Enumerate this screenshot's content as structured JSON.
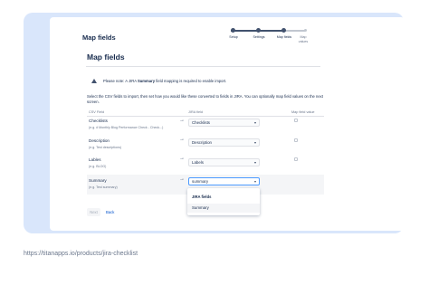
{
  "header": {
    "title": "Map fields"
  },
  "steps": [
    {
      "label": "Setup",
      "state": "done"
    },
    {
      "label": "Settings",
      "state": "done"
    },
    {
      "label": "Map fields",
      "state": "current"
    },
    {
      "label": "Map values",
      "state": "upcoming"
    }
  ],
  "section": {
    "title": "Map fields"
  },
  "notice": {
    "icon": "warning-icon",
    "prefix": "Please note: A JIRA ",
    "bold": "Summary",
    "suffix": " field mapping is required to enable import."
  },
  "description": "Select the CSV fields to import, then set how you would like these converted to fields in JIRA. You can optionally map field values on the next screen.",
  "table": {
    "headers": {
      "csv": "CSV Field",
      "jira": "JIRA field",
      "map": "Map field value"
    },
    "rows": [
      {
        "name": "Checklists",
        "example": "(e.g. # Monthly Blog Performance Check - Check...)",
        "jira": "Checklists"
      },
      {
        "name": "Description",
        "example": "(e.g. Test descriptions)",
        "jira": "Description"
      },
      {
        "name": "Lables",
        "example": "(e.g. BLOG)",
        "jira": "Labels"
      },
      {
        "name": "Summary",
        "example": "(e.g. Test summary)",
        "jira": "summary"
      }
    ]
  },
  "dropdown": {
    "group": "JIRA fields",
    "option": "Summary"
  },
  "buttons": {
    "next": "Next",
    "back": "Back"
  },
  "footer": {
    "url": "https://titanapps.io/products/jira-checklist"
  },
  "colors": {
    "accent": "#0052cc",
    "background_panel": "#d9e6fb",
    "focus": "#4c9aff"
  }
}
